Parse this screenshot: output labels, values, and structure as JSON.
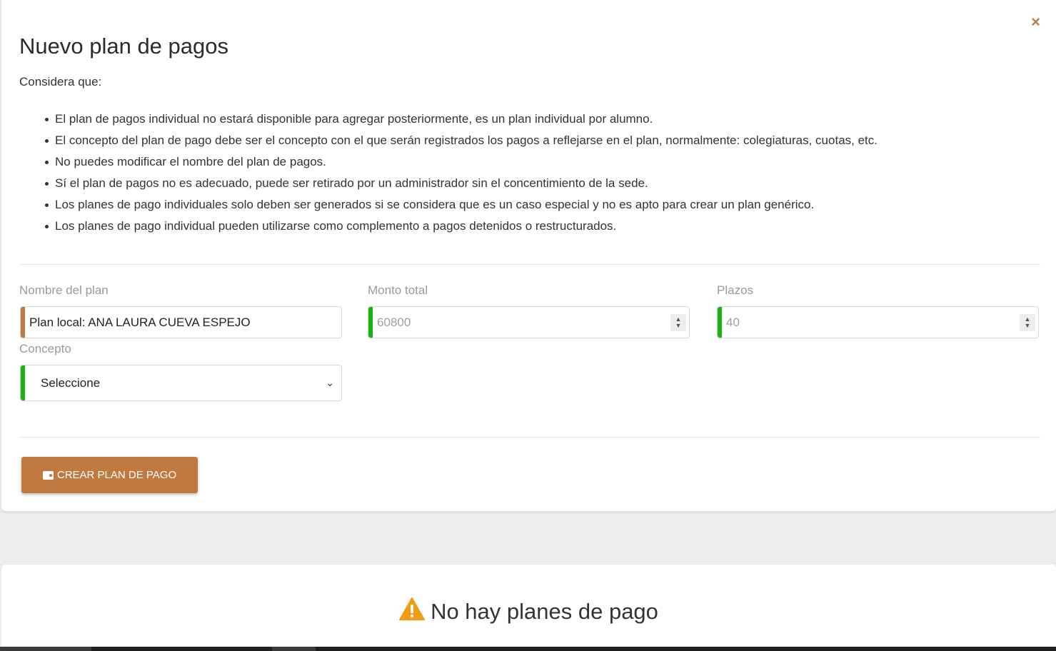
{
  "modal": {
    "title": "Nuevo plan de pagos",
    "close_icon": "×",
    "intro": "Considera que:",
    "notes": [
      "El plan de pagos individual no estará disponible para agregar posteriormente, es un plan individual por alumno.",
      "El concepto del plan de pago debe ser el concepto con el que serán registrados los pagos a reflejarse en el plan, normalmente: colegiaturas, cuotas, etc.",
      "No puedes modificar el nombre del plan de pagos.",
      "Sí el plan de pagos no es adecuado, puede ser retirado por un administrador sin el concentimiento de la sede.",
      "Los planes de pago individuales solo deben ser generados si se considera que es un caso especial y no es apto para crear un plan genérico.",
      "Los planes de pago individual pueden utilizarse como complemento a pagos detenidos o restructurados."
    ]
  },
  "form": {
    "plan_name": {
      "label": "Nombre del plan",
      "value": "Plan local: ANA LAURA CUEVA ESPEJO",
      "accent": "#c07a3f"
    },
    "total": {
      "label": "Monto total",
      "value": "60800",
      "accent": "#19b319"
    },
    "terms": {
      "label": "Plazos",
      "value": "40",
      "accent": "#19b319"
    },
    "concept": {
      "label": "Concepto",
      "selected": "Seleccione",
      "accent": "#19b319"
    },
    "submit_label": "Crear plan de pago",
    "submit_icon": "wallet-icon"
  },
  "empty_state": {
    "icon": "warning-icon",
    "message": "No hay planes de pago"
  },
  "colors": {
    "brand": "#c07a3f",
    "valid": "#19b319",
    "warning": "#f39c12"
  }
}
